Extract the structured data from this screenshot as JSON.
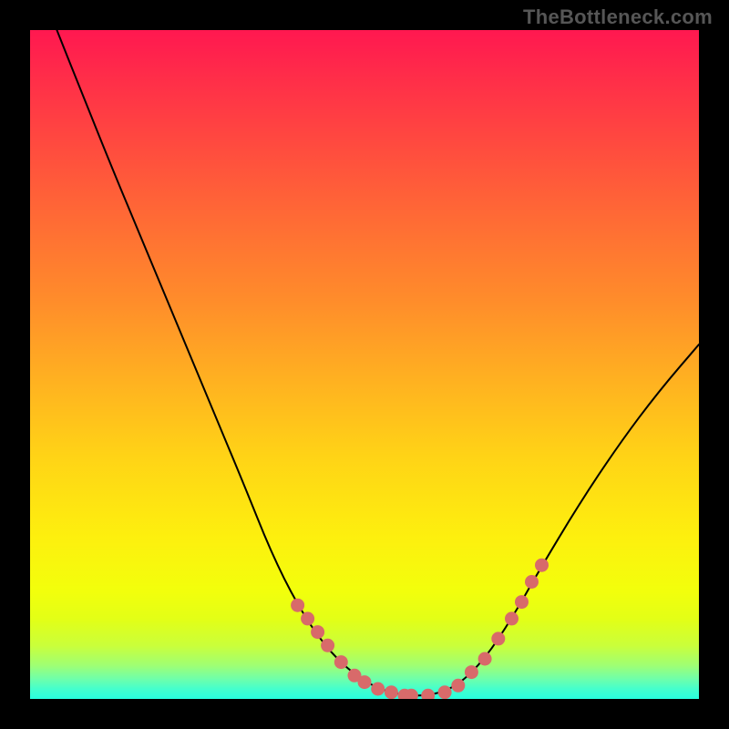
{
  "watermark": "TheBottleneck.com",
  "colors": {
    "background": "#000000",
    "curve": "#000000",
    "dots": "#d86a6a",
    "gradient_top": "#ff1850",
    "gradient_bottom": "#28ffde"
  },
  "chart_data": {
    "type": "line",
    "title": "",
    "xlabel": "",
    "ylabel": "",
    "xlim": [
      0,
      100
    ],
    "ylim": [
      0,
      100
    ],
    "curve_points": [
      {
        "x": 4,
        "y": 100
      },
      {
        "x": 8,
        "y": 90
      },
      {
        "x": 12,
        "y": 80
      },
      {
        "x": 17,
        "y": 68
      },
      {
        "x": 22,
        "y": 56
      },
      {
        "x": 27,
        "y": 44
      },
      {
        "x": 32,
        "y": 32
      },
      {
        "x": 36,
        "y": 22
      },
      {
        "x": 40,
        "y": 14
      },
      {
        "x": 44,
        "y": 8
      },
      {
        "x": 48,
        "y": 4
      },
      {
        "x": 52,
        "y": 1.5
      },
      {
        "x": 56,
        "y": 0.5
      },
      {
        "x": 60,
        "y": 0.5
      },
      {
        "x": 64,
        "y": 2
      },
      {
        "x": 68,
        "y": 6
      },
      {
        "x": 72,
        "y": 12
      },
      {
        "x": 76,
        "y": 19
      },
      {
        "x": 82,
        "y": 29
      },
      {
        "x": 88,
        "y": 38
      },
      {
        "x": 94,
        "y": 46
      },
      {
        "x": 100,
        "y": 53
      }
    ],
    "highlight_points": [
      {
        "x": 40,
        "y": 14
      },
      {
        "x": 41.5,
        "y": 12
      },
      {
        "x": 43,
        "y": 10
      },
      {
        "x": 44.5,
        "y": 8
      },
      {
        "x": 46.5,
        "y": 5.5
      },
      {
        "x": 48.5,
        "y": 3.5
      },
      {
        "x": 50,
        "y": 2.5
      },
      {
        "x": 52,
        "y": 1.5
      },
      {
        "x": 54,
        "y": 1
      },
      {
        "x": 56,
        "y": 0.5
      },
      {
        "x": 57,
        "y": 0.5
      },
      {
        "x": 59.5,
        "y": 0.5
      },
      {
        "x": 62,
        "y": 1
      },
      {
        "x": 64,
        "y": 2
      },
      {
        "x": 66,
        "y": 4
      },
      {
        "x": 68,
        "y": 6
      },
      {
        "x": 70,
        "y": 9
      },
      {
        "x": 72,
        "y": 12
      },
      {
        "x": 73.5,
        "y": 14.5
      },
      {
        "x": 75,
        "y": 17.5
      },
      {
        "x": 76.5,
        "y": 20
      }
    ]
  }
}
